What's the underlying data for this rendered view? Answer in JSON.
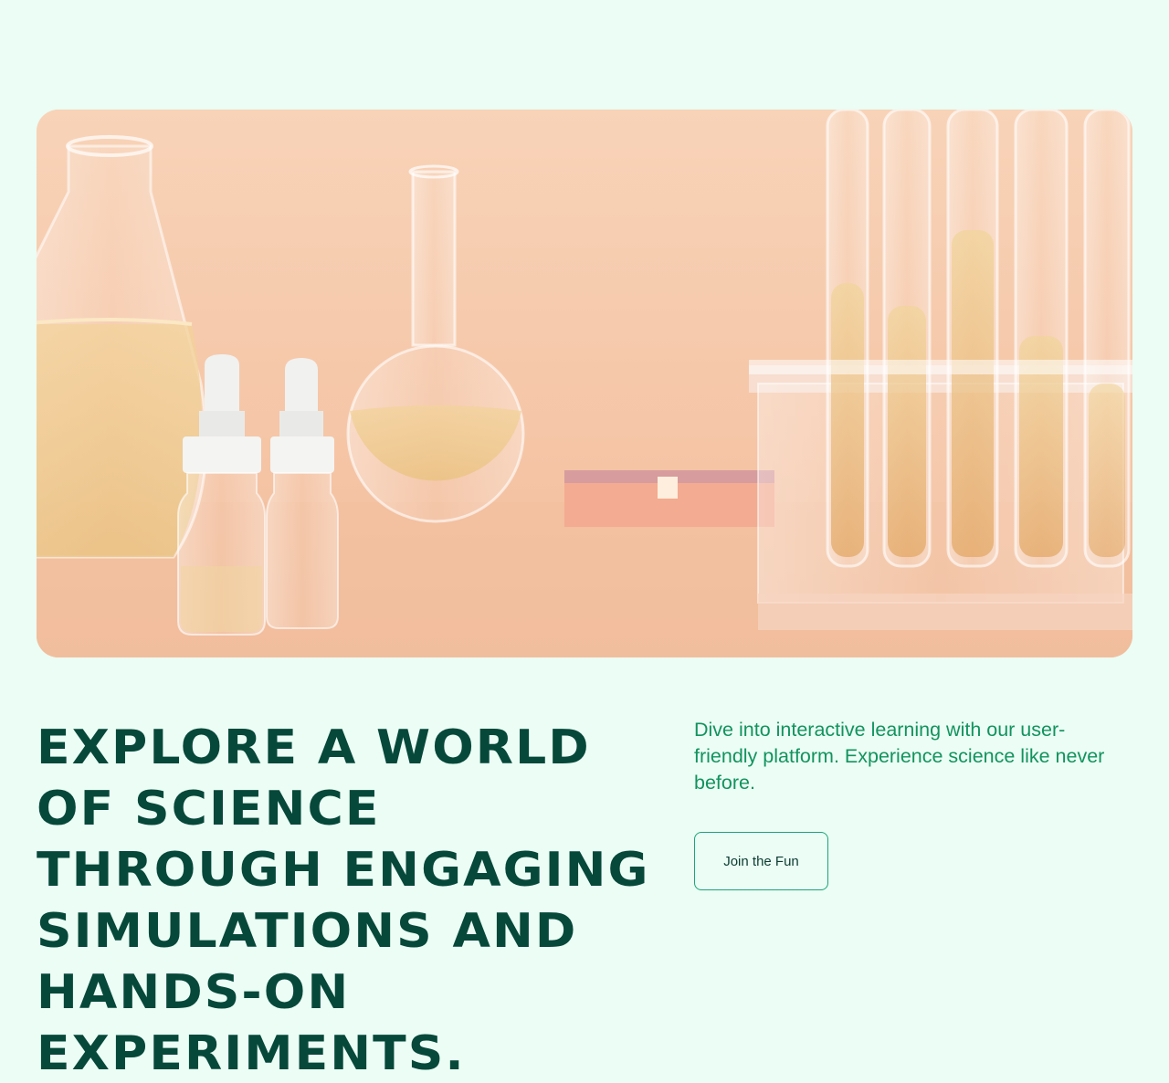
{
  "hero": {
    "image_icon": "lab-glassware-illustration",
    "headline": "Explore a world of science through engaging simulations and hands-on experiments.",
    "description": "Dive into interactive learning with our user-friendly platform. Experience science like never before.",
    "cta_label": "Join the Fun"
  },
  "colors": {
    "background": "#ebfdf4",
    "headline": "#06483a",
    "description": "#12935e",
    "button_border": "#1aa57a",
    "image_backdrop": "#f4c3a4"
  }
}
